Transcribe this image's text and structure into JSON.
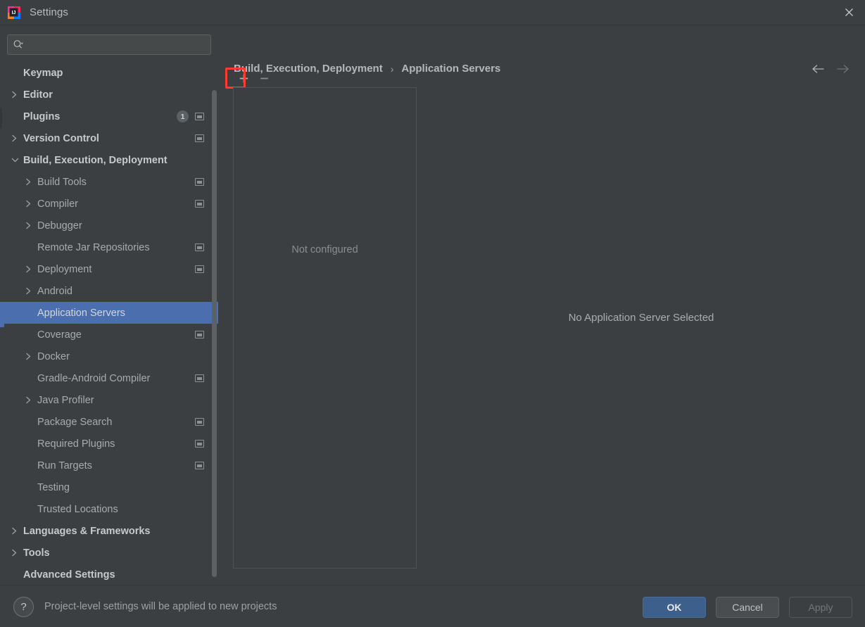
{
  "window": {
    "title": "Settings",
    "app_icon": "intellij-idea-logo",
    "close_label": "✕"
  },
  "search": {
    "placeholder": "",
    "value": "",
    "icon": "search-icon"
  },
  "sidebar": {
    "items": [
      {
        "label": "Keymap",
        "level": 0,
        "expander": "none",
        "bold": true,
        "badge": null,
        "project_icon": false,
        "selected": false
      },
      {
        "label": "Editor",
        "level": 0,
        "expander": "collapsed",
        "bold": true,
        "badge": null,
        "project_icon": false,
        "selected": false
      },
      {
        "label": "Plugins",
        "level": 0,
        "expander": "none",
        "bold": true,
        "badge": "1",
        "project_icon": true,
        "selected": false
      },
      {
        "label": "Version Control",
        "level": 0,
        "expander": "collapsed",
        "bold": true,
        "badge": null,
        "project_icon": true,
        "selected": false
      },
      {
        "label": "Build, Execution, Deployment",
        "level": 0,
        "expander": "expanded",
        "bold": true,
        "badge": null,
        "project_icon": false,
        "selected": false
      },
      {
        "label": "Build Tools",
        "level": 1,
        "expander": "collapsed",
        "bold": false,
        "badge": null,
        "project_icon": true,
        "selected": false
      },
      {
        "label": "Compiler",
        "level": 1,
        "expander": "collapsed",
        "bold": false,
        "badge": null,
        "project_icon": true,
        "selected": false
      },
      {
        "label": "Debugger",
        "level": 1,
        "expander": "collapsed",
        "bold": false,
        "badge": null,
        "project_icon": false,
        "selected": false
      },
      {
        "label": "Remote Jar Repositories",
        "level": 1,
        "expander": "none",
        "bold": false,
        "badge": null,
        "project_icon": true,
        "selected": false
      },
      {
        "label": "Deployment",
        "level": 1,
        "expander": "collapsed",
        "bold": false,
        "badge": null,
        "project_icon": true,
        "selected": false
      },
      {
        "label": "Android",
        "level": 1,
        "expander": "collapsed",
        "bold": false,
        "badge": null,
        "project_icon": false,
        "selected": false
      },
      {
        "label": "Application Servers",
        "level": 1,
        "expander": "none",
        "bold": false,
        "badge": null,
        "project_icon": false,
        "selected": true
      },
      {
        "label": "Coverage",
        "level": 1,
        "expander": "none",
        "bold": false,
        "badge": null,
        "project_icon": true,
        "selected": false
      },
      {
        "label": "Docker",
        "level": 1,
        "expander": "collapsed",
        "bold": false,
        "badge": null,
        "project_icon": false,
        "selected": false
      },
      {
        "label": "Gradle-Android Compiler",
        "level": 1,
        "expander": "none",
        "bold": false,
        "badge": null,
        "project_icon": true,
        "selected": false
      },
      {
        "label": "Java Profiler",
        "level": 1,
        "expander": "collapsed",
        "bold": false,
        "badge": null,
        "project_icon": false,
        "selected": false
      },
      {
        "label": "Package Search",
        "level": 1,
        "expander": "none",
        "bold": false,
        "badge": null,
        "project_icon": true,
        "selected": false
      },
      {
        "label": "Required Plugins",
        "level": 1,
        "expander": "none",
        "bold": false,
        "badge": null,
        "project_icon": true,
        "selected": false
      },
      {
        "label": "Run Targets",
        "level": 1,
        "expander": "none",
        "bold": false,
        "badge": null,
        "project_icon": true,
        "selected": false
      },
      {
        "label": "Testing",
        "level": 1,
        "expander": "none",
        "bold": false,
        "badge": null,
        "project_icon": false,
        "selected": false
      },
      {
        "label": "Trusted Locations",
        "level": 1,
        "expander": "none",
        "bold": false,
        "badge": null,
        "project_icon": false,
        "selected": false
      },
      {
        "label": "Languages & Frameworks",
        "level": 0,
        "expander": "collapsed",
        "bold": true,
        "badge": null,
        "project_icon": false,
        "selected": false
      },
      {
        "label": "Tools",
        "level": 0,
        "expander": "collapsed",
        "bold": true,
        "badge": null,
        "project_icon": false,
        "selected": false
      },
      {
        "label": "Advanced Settings",
        "level": 0,
        "expander": "none",
        "bold": true,
        "badge": null,
        "project_icon": false,
        "selected": false
      }
    ]
  },
  "breadcrumb": {
    "parent": "Build, Execution, Deployment",
    "separator": "›",
    "current": "Application Servers"
  },
  "nav": {
    "back_icon": "arrow-left-icon",
    "forward_icon": "arrow-right-icon"
  },
  "toolbar": {
    "add_label": "+",
    "remove_label": "−"
  },
  "list_panel": {
    "empty_text": "Not configured"
  },
  "detail_panel": {
    "empty_text": "No Application Server Selected"
  },
  "footer": {
    "help_label": "?",
    "note": "Project-level settings will be applied to new projects",
    "ok_label": "OK",
    "cancel_label": "Cancel",
    "apply_label": "Apply"
  },
  "colors": {
    "background": "#3c3f41",
    "selection_blue": "#4b6eaf",
    "highlight_red": "#ff3b30",
    "primary_button": "#3c5f8c",
    "text": "#bababa",
    "muted_text": "#8a8e91"
  }
}
